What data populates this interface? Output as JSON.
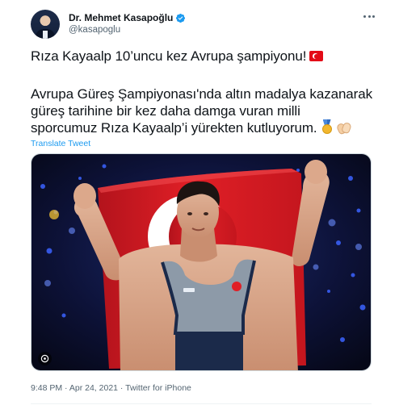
{
  "author": {
    "name": "Dr. Mehmet Kasapoğlu",
    "handle": "@kasapoglu",
    "verified_icon": "verified-badge-icon",
    "verified_color": "#1d9bf0"
  },
  "tweet": {
    "line1": "Rıza Kayaalp 10’uncu kez Avrupa şampiyonu!",
    "line2": "Avrupa Güreş Şampiyonası'nda altın madalya kazanarak",
    "line3": "güreş tarihine bir kez daha damga vuran milli",
    "line4": "sporcumuz Rıza Kayaalp’i yürekten kutluyorum.",
    "emojis": [
      "turkey-flag-icon",
      "gold-medal-icon",
      "clapping-hands-icon"
    ],
    "translate_label": "Translate Tweet"
  },
  "meta": {
    "time": "9:48 PM",
    "separator": " · ",
    "date": "Apr 24, 2021",
    "source": "Twitter for iPhone"
  },
  "colors": {
    "link": "#1d9bf0",
    "secondary_text": "#536471",
    "flag_red": "#e30a17"
  }
}
